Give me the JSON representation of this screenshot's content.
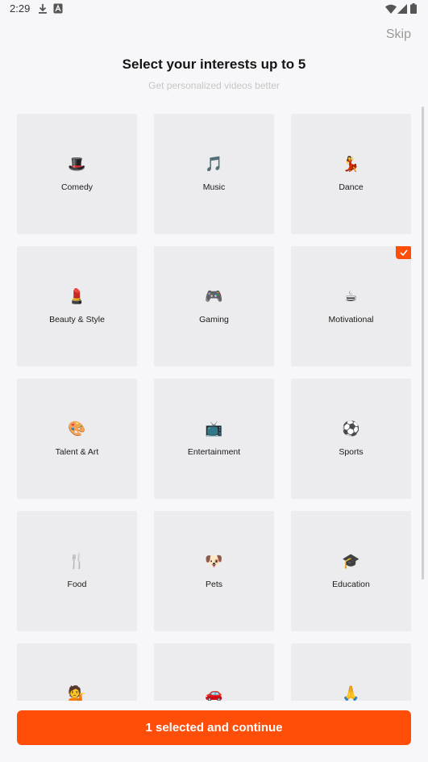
{
  "status_bar": {
    "time": "2:29",
    "icons": [
      "download-icon",
      "a-notification-icon",
      "wifi-icon",
      "signal-icon",
      "battery-icon"
    ]
  },
  "header": {
    "skip_label": "Skip",
    "title": "Select your interests up to 5",
    "subtitle": "Get personalized videos better"
  },
  "interests": [
    {
      "label": "Comedy",
      "emoji": "🎩",
      "icon": "top-hat-icon",
      "selected": false
    },
    {
      "label": "Music",
      "emoji": "🎵",
      "icon": "music-note-icon",
      "selected": false
    },
    {
      "label": "Dance",
      "emoji": "💃",
      "icon": "dancer-icon",
      "selected": false
    },
    {
      "label": "Beauty & Style",
      "emoji": "💄",
      "icon": "lipstick-icon",
      "selected": false
    },
    {
      "label": "Gaming",
      "emoji": "🎮",
      "icon": "gamepad-icon",
      "selected": false
    },
    {
      "label": "Motivational",
      "emoji": "☕",
      "icon": "coffee-icon",
      "selected": true
    },
    {
      "label": "Talent & Art",
      "emoji": "🎨",
      "icon": "palette-icon",
      "selected": false
    },
    {
      "label": "Entertainment",
      "emoji": "📺",
      "icon": "tv-icon",
      "selected": false
    },
    {
      "label": "Sports",
      "emoji": "⚽",
      "icon": "soccer-ball-icon",
      "selected": false
    },
    {
      "label": "Food",
      "emoji": "🍴",
      "icon": "fork-knife-icon",
      "selected": false
    },
    {
      "label": "Pets",
      "emoji": "🐶",
      "icon": "dog-icon",
      "selected": false
    },
    {
      "label": "Education",
      "emoji": "🎓",
      "icon": "graduation-cap-icon",
      "selected": false
    },
    {
      "label": "",
      "emoji": "💁",
      "icon": "person-tipping-hand-icon",
      "selected": false
    },
    {
      "label": "",
      "emoji": "🚗",
      "icon": "car-icon",
      "selected": false
    },
    {
      "label": "",
      "emoji": "🙏",
      "icon": "folded-hands-icon",
      "selected": false
    }
  ],
  "footer": {
    "continue_label": "1 selected and continue"
  },
  "colors": {
    "accent": "#ff4d0a",
    "tile_bg": "#ececee",
    "page_bg": "#f7f7f9"
  }
}
